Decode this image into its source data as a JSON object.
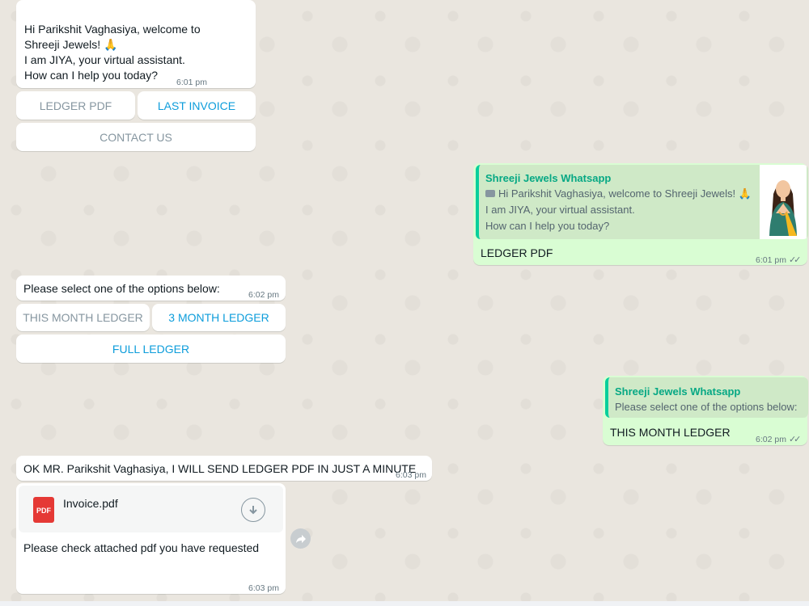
{
  "messages": {
    "welcome": {
      "line1": "Hi Parikshit Vaghasiya, welcome to",
      "line2": "Shreeji Jewels! 🙏",
      "line3": "I am JIYA, your virtual assistant.",
      "line4": "How can I help you today?",
      "time": "6:01 pm",
      "buttons": {
        "ledger_pdf": "LEDGER PDF",
        "last_invoice": "LAST INVOICE",
        "contact_us": "CONTACT US"
      }
    },
    "reply1": {
      "quote_title": "Shreeji Jewels Whatsapp",
      "quote_line1": "Hi Parikshit Vaghasiya, welcome to Shreeji Jewels! 🙏",
      "quote_line2": "I am JIYA, your virtual assistant.",
      "quote_line3": "How can I help you today?",
      "text": "LEDGER PDF",
      "time": "6:01 pm",
      "ticks": "✓✓"
    },
    "options": {
      "text": "Please select one of the options below:",
      "time": "6:02 pm",
      "buttons": {
        "this_month": "THIS MONTH LEDGER",
        "three_month": "3 MONTH LEDGER",
        "full": "FULL LEDGER"
      }
    },
    "reply2": {
      "quote_title": "Shreeji Jewels Whatsapp",
      "quote_line1": "Please select one of the options below:",
      "text": "THIS MONTH LEDGER",
      "time": "6:02 pm",
      "ticks": "✓✓"
    },
    "confirm": {
      "text": "OK MR. Parikshit Vaghasiya, I WILL SEND LEDGER PDF IN JUST A MINUTE",
      "time": "6:03 pm"
    },
    "document": {
      "icon_label": "PDF",
      "filename": "Invoice.pdf",
      "caption": "Please check attached pdf you have requested",
      "time": "6:03 pm"
    }
  },
  "colors": {
    "background": "#eae6df",
    "outgoing": "#d9fdd3",
    "accent_green": "#06cf9c",
    "button_blue": "#0d9ddb"
  }
}
